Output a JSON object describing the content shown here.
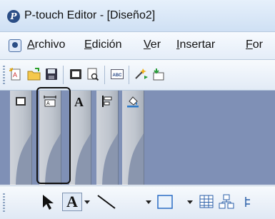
{
  "window": {
    "title": "P-touch Editor - [Diseño2]"
  },
  "menu": {
    "items": [
      {
        "label": "Archivo",
        "underline": "A",
        "rest": "rchivo"
      },
      {
        "label": "Edición",
        "underline": "E",
        "rest": "dición"
      },
      {
        "label": "Ver",
        "underline": "V",
        "rest": "er"
      },
      {
        "label": "Insertar",
        "underline": "I",
        "rest": "nsertar"
      },
      {
        "label": "For",
        "underline": "F",
        "rest": "or"
      }
    ]
  },
  "toolbar": {
    "icons": [
      "new-label-icon",
      "open-folder-icon",
      "save-icon",
      "print-icon",
      "print-preview-icon",
      "barcode-settings-icon",
      "wizard-icon",
      "transfer-icon"
    ]
  },
  "side_tabs": {
    "icons": [
      "layout-tab-icon",
      "text-frame-tab-icon",
      "text-style-tab-icon",
      "align-tab-icon",
      "fill-tab-icon"
    ]
  },
  "drawing_toolbar": {
    "text_glyph": "A",
    "icons": [
      "select-arrow-icon",
      "text-tool-icon",
      "line-tool-icon",
      "rectangle-tool-icon",
      "table-tool-icon",
      "database-tool-icon"
    ]
  }
}
